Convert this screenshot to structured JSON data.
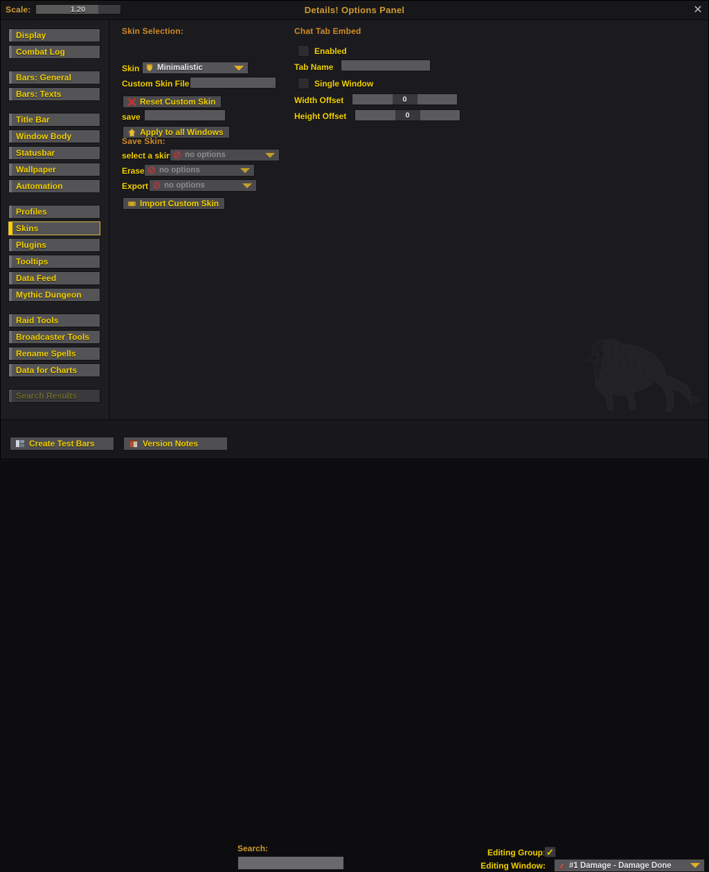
{
  "window": {
    "title": "Details! Options Panel",
    "close_label": "✕",
    "scale_label": "Scale:",
    "scale_value": "1.20",
    "scale_percent": 74
  },
  "sidebar": {
    "groups": [
      {
        "items": [
          {
            "label": "Display",
            "state": "normal"
          },
          {
            "label": "Combat Log",
            "state": "normal"
          }
        ]
      },
      {
        "items": [
          {
            "label": "Bars: General",
            "state": "normal"
          },
          {
            "label": "Bars: Texts",
            "state": "normal"
          }
        ]
      },
      {
        "items": [
          {
            "label": "Title Bar",
            "state": "normal"
          },
          {
            "label": "Window Body",
            "state": "normal"
          },
          {
            "label": "Statusbar",
            "state": "normal"
          },
          {
            "label": "Wallpaper",
            "state": "normal"
          },
          {
            "label": "Automation",
            "state": "normal"
          }
        ]
      },
      {
        "items": [
          {
            "label": "Profiles",
            "state": "normal"
          },
          {
            "label": "Skins",
            "state": "selected"
          },
          {
            "label": "Plugins",
            "state": "normal"
          },
          {
            "label": "Tooltips",
            "state": "normal"
          },
          {
            "label": "Data Feed",
            "state": "normal"
          },
          {
            "label": "Mythic Dungeon",
            "state": "normal"
          }
        ]
      },
      {
        "items": [
          {
            "label": "Raid Tools",
            "state": "normal"
          },
          {
            "label": "Broadcaster Tools",
            "state": "normal"
          },
          {
            "label": "Rename Spells",
            "state": "normal"
          },
          {
            "label": "Data for Charts",
            "state": "normal"
          }
        ]
      },
      {
        "items": [
          {
            "label": "Search Results",
            "state": "muted"
          }
        ]
      }
    ]
  },
  "skin_selection": {
    "heading": "Skin Selection:",
    "skin_label": "Skin",
    "skin_value": "Minimalistic",
    "skin_icon": "shield-icon",
    "custom_skin_file_label": "Custom Skin File",
    "custom_skin_file_value": "",
    "reset_button": "Reset Custom Skin",
    "reset_icon": "red-x-icon",
    "save_label": "save",
    "save_value": "",
    "apply_button": "Apply to all Windows",
    "apply_icon": "home-icon"
  },
  "save_skin": {
    "heading": "Save Skin:",
    "select_skin_label": "select a skin",
    "select_skin_value": "no options",
    "erase_label": "Erase",
    "erase_value": "no options",
    "export_label": "Export",
    "export_value": "no options",
    "no_options_icon": "red-circle-slash-icon",
    "import_button": "Import Custom Skin",
    "import_icon": "scroll-icon"
  },
  "chat_tab_embed": {
    "heading": "Chat Tab Embed",
    "enabled_label": "Enabled",
    "enabled_checked": false,
    "tab_name_label": "Tab Name",
    "tab_name_value": "",
    "single_window_label": "Single Window",
    "single_window_checked": false,
    "width_offset_label": "Width Offset",
    "width_offset_value": "0",
    "height_offset_label": "Height Offset",
    "height_offset_value": "0"
  },
  "bottom_bar": {
    "create_test_bars": "Create Test Bars",
    "create_test_bars_icon": "bars-icon",
    "version_notes": "Version Notes",
    "version_notes_icon": "book-icon",
    "search_label": "Search:",
    "search_value": "",
    "editing_group_label": "Editing Group:",
    "editing_group_checked": true,
    "editing_group_check_glyph": "✓",
    "editing_window_label": "Editing Window:",
    "editing_window_value": "#1 Damage - Damage Done",
    "editing_window_icon": "damage-icon"
  },
  "decoration": {
    "watermark": "lion-watermark"
  },
  "colors": {
    "accent_gold": "#cf9b30",
    "label_yellow": "#f3d000",
    "panel_bg": "#1b1b1f",
    "sidebar_bg": "#1e1e22",
    "widget_bg": "#55555a"
  }
}
